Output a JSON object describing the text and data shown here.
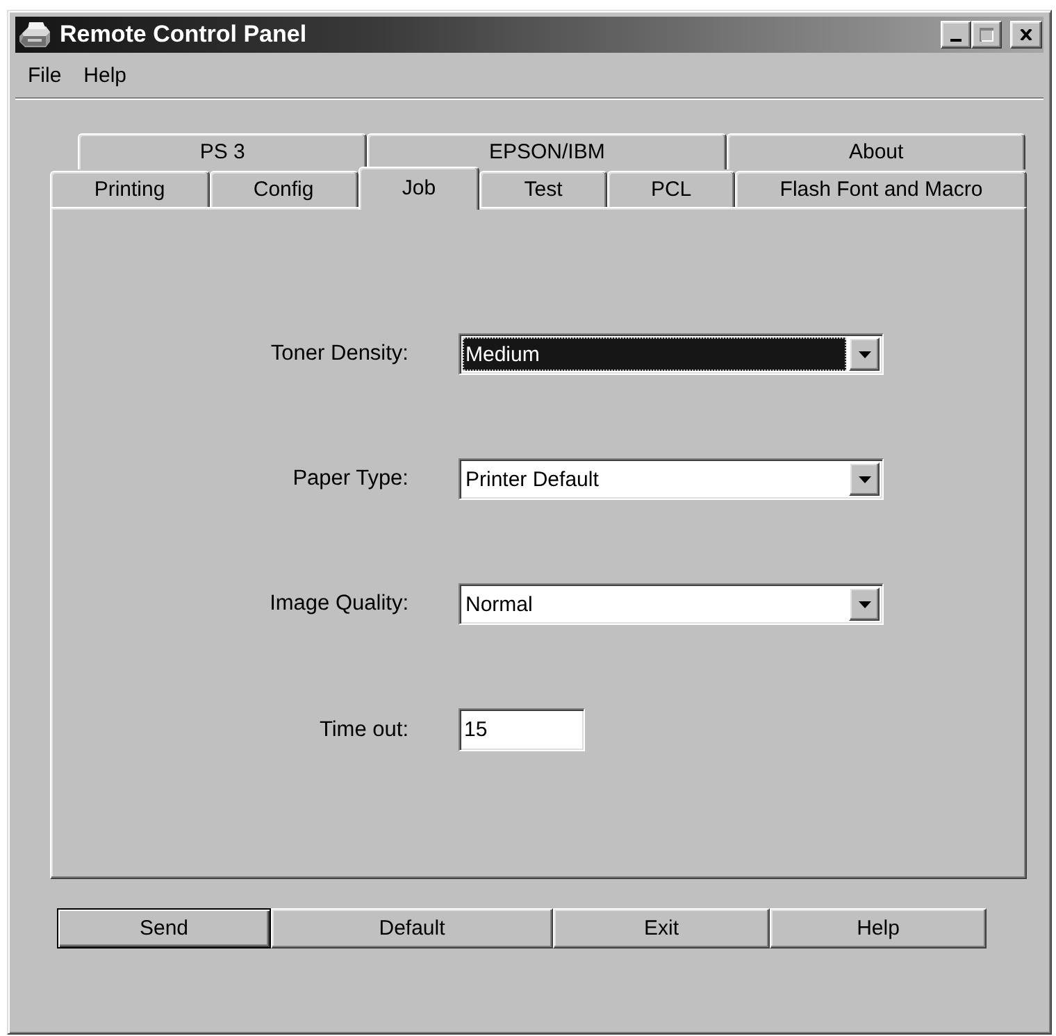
{
  "window": {
    "title": "Remote Control Panel",
    "controls": [
      {
        "kind": "minimize",
        "disabled": false
      },
      {
        "kind": "maximize",
        "disabled": true
      },
      {
        "kind": "close",
        "disabled": false
      }
    ]
  },
  "menu": [
    {
      "label": "File"
    },
    {
      "label": "Help"
    }
  ],
  "tab_rows": [
    {
      "tabs": [
        {
          "label": "PS 3",
          "selected": false
        },
        {
          "label": "EPSON/IBM",
          "selected": false
        },
        {
          "label": "About",
          "selected": false
        }
      ]
    },
    {
      "tabs": [
        {
          "label": "Printing",
          "selected": false
        },
        {
          "label": "Config",
          "selected": false
        },
        {
          "label": "Job",
          "selected": true
        },
        {
          "label": "Test",
          "selected": false
        },
        {
          "label": "PCL",
          "selected": false
        },
        {
          "label": "Flash Font and Macro",
          "selected": false
        }
      ]
    }
  ],
  "panel": {
    "fields": [
      {
        "kind": "dropdown",
        "label": "Toner Density:",
        "value": "Medium",
        "focused": true
      },
      {
        "kind": "dropdown",
        "label": "Paper Type:",
        "value": "Printer Default",
        "focused": false
      },
      {
        "kind": "dropdown",
        "label": "Image Quality:",
        "value": "Normal",
        "focused": false
      },
      {
        "kind": "text",
        "label": "Time out:",
        "value": "15",
        "focused": false
      }
    ]
  },
  "buttons": [
    {
      "label": "Send",
      "default": true
    },
    {
      "label": "Default",
      "default": false
    },
    {
      "label": "Exit",
      "default": false
    },
    {
      "label": "Help",
      "default": false
    }
  ]
}
